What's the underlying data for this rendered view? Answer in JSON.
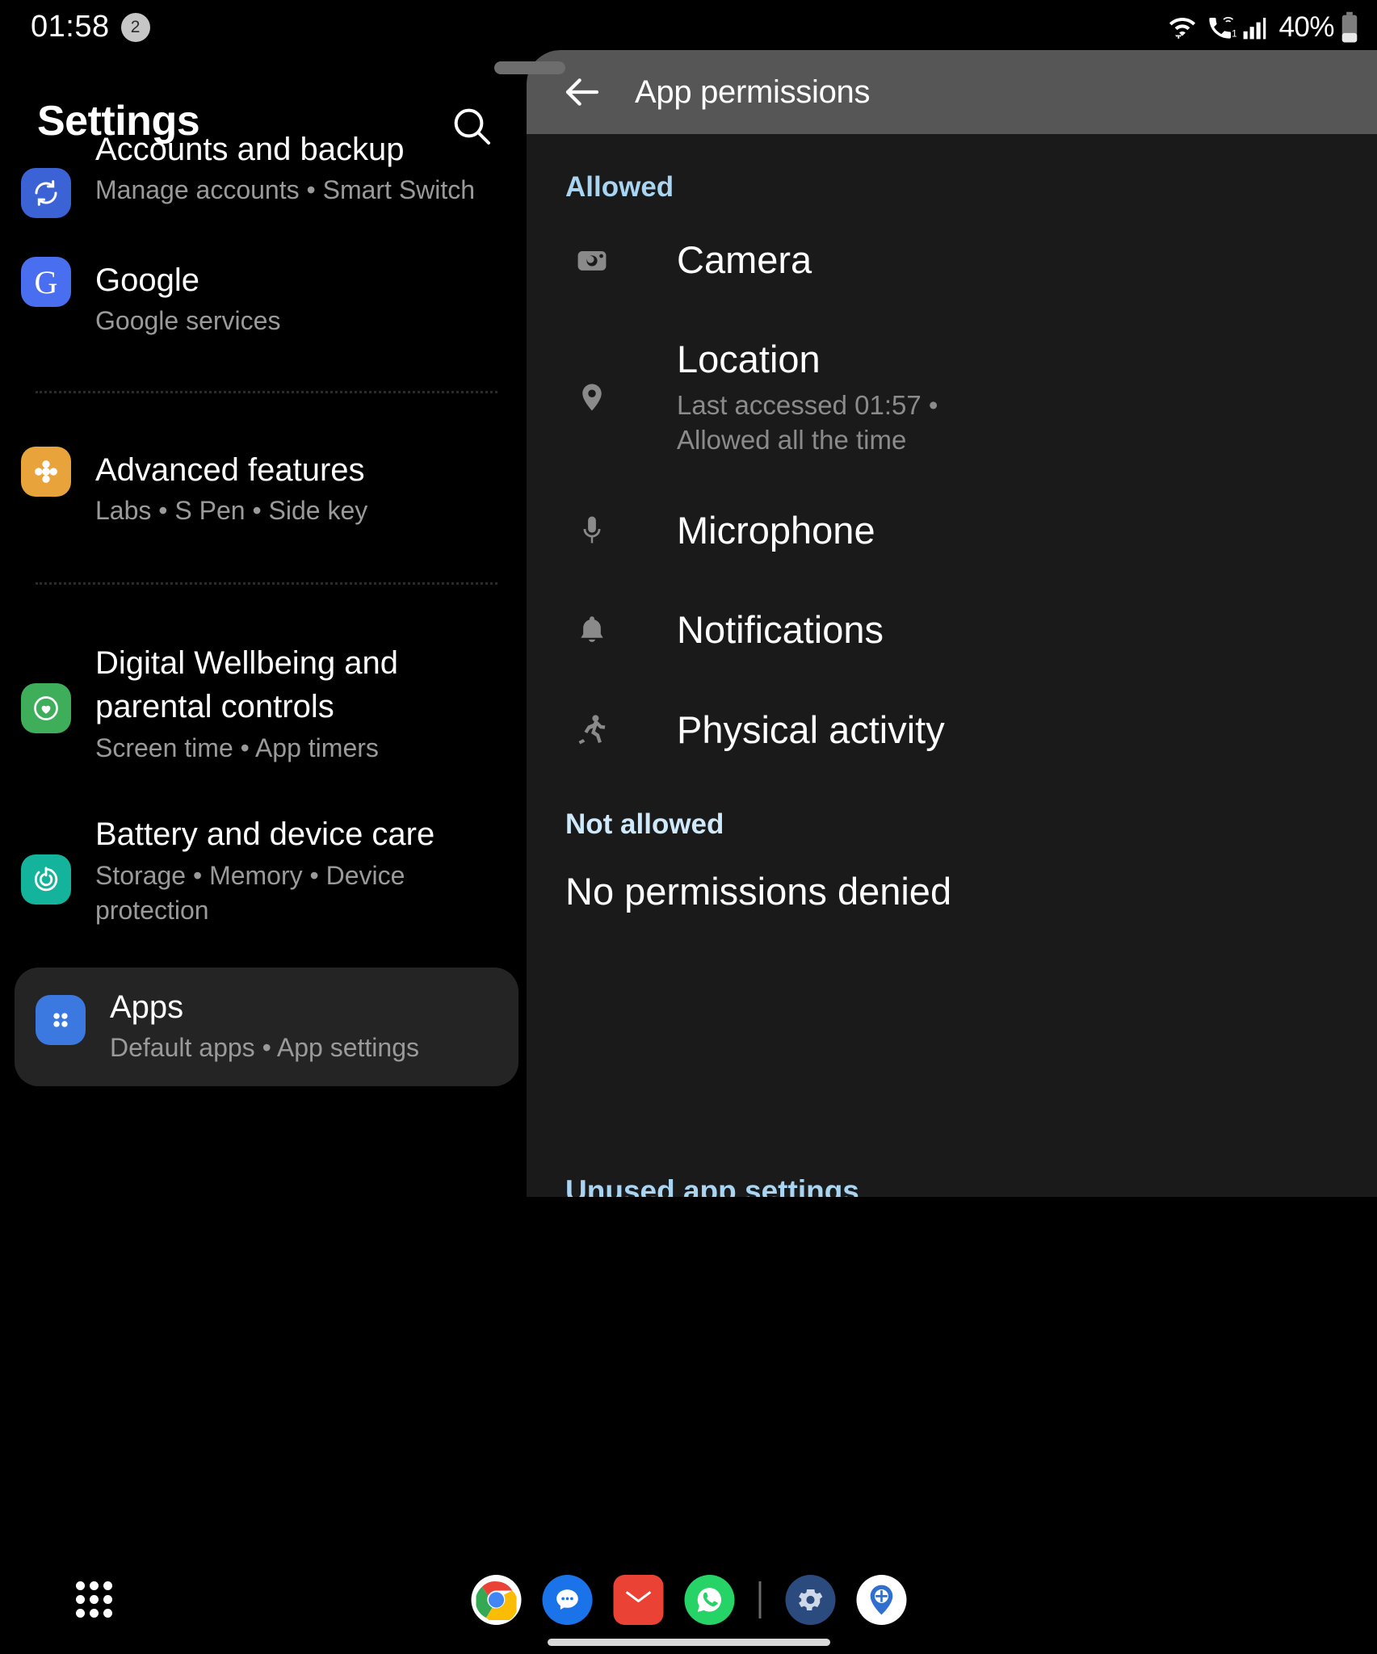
{
  "status_bar": {
    "time": "01:58",
    "notification_count": "2",
    "battery_percent": "40%",
    "icons": [
      "wifi-data-icon",
      "vowifi-call-icon",
      "signal-bars-icon",
      "battery-icon"
    ],
    "sim_label": "1"
  },
  "settings": {
    "title": "Settings",
    "search_icon": "search-icon",
    "items": [
      {
        "title": "Accounts and backup",
        "subtitle": "Manage accounts  •  Smart Switch",
        "icon": "sync-icon",
        "icon_color": "#3b63d6",
        "clipped": true
      },
      {
        "title": "Google",
        "subtitle": "Google services",
        "icon": "google-g-icon",
        "icon_color": "#4a6ef0"
      },
      {
        "title": "Advanced features",
        "subtitle": "Labs  •  S Pen  •  Side key",
        "icon": "puzzle-icon",
        "icon_color": "#e8a33a"
      },
      {
        "title": "Digital Wellbeing and parental controls",
        "subtitle": "Screen time  •  App timers",
        "icon": "wellbeing-icon",
        "icon_color": "#3fae5a"
      },
      {
        "title": "Battery and device care",
        "subtitle": "Storage  •  Memory  •  Device protection",
        "icon": "device-care-icon",
        "icon_color": "#14b39b"
      },
      {
        "title": "Apps",
        "subtitle": "Default apps  •  App settings",
        "icon": "apps-grid-icon",
        "icon_color": "#3b78e0",
        "selected": true
      }
    ]
  },
  "popup": {
    "title": "App permissions",
    "back_icon": "back-arrow-icon",
    "menu_icon": "more-vertical-icon",
    "drag_handle": "window-drag-handle",
    "sections": [
      {
        "heading": "Allowed",
        "heading_color": "#a9d4f2",
        "permissions": [
          {
            "name": "Camera",
            "icon": "camera-icon",
            "subtitle": ""
          },
          {
            "name": "Location",
            "icon": "location-pin-icon",
            "subtitle": "Last accessed 01:57 •\nAllowed all the time"
          },
          {
            "name": "Microphone",
            "icon": "microphone-icon",
            "subtitle": ""
          },
          {
            "name": "Notifications",
            "icon": "bell-icon",
            "subtitle": ""
          },
          {
            "name": "Physical activity",
            "icon": "running-person-icon",
            "subtitle": ""
          }
        ]
      },
      {
        "heading": "Not allowed",
        "heading_color": "#cfe9fb",
        "empty_text": "No permissions denied",
        "permissions": []
      }
    ],
    "clipped_footer": "Unused app settings"
  },
  "dock": {
    "apps_icon": "app-drawer-icon",
    "items": [
      {
        "name": "Chrome",
        "icon": "chrome-icon"
      },
      {
        "name": "Messages",
        "icon": "messages-icon"
      },
      {
        "name": "Gmail",
        "icon": "gmail-icon"
      },
      {
        "name": "WhatsApp",
        "icon": "whatsapp-icon"
      },
      {
        "name": "Settings",
        "icon": "gear-icon"
      },
      {
        "name": "Maps",
        "icon": "maps-pin-icon"
      }
    ],
    "gesture_bar": "home-gesture-bar"
  }
}
